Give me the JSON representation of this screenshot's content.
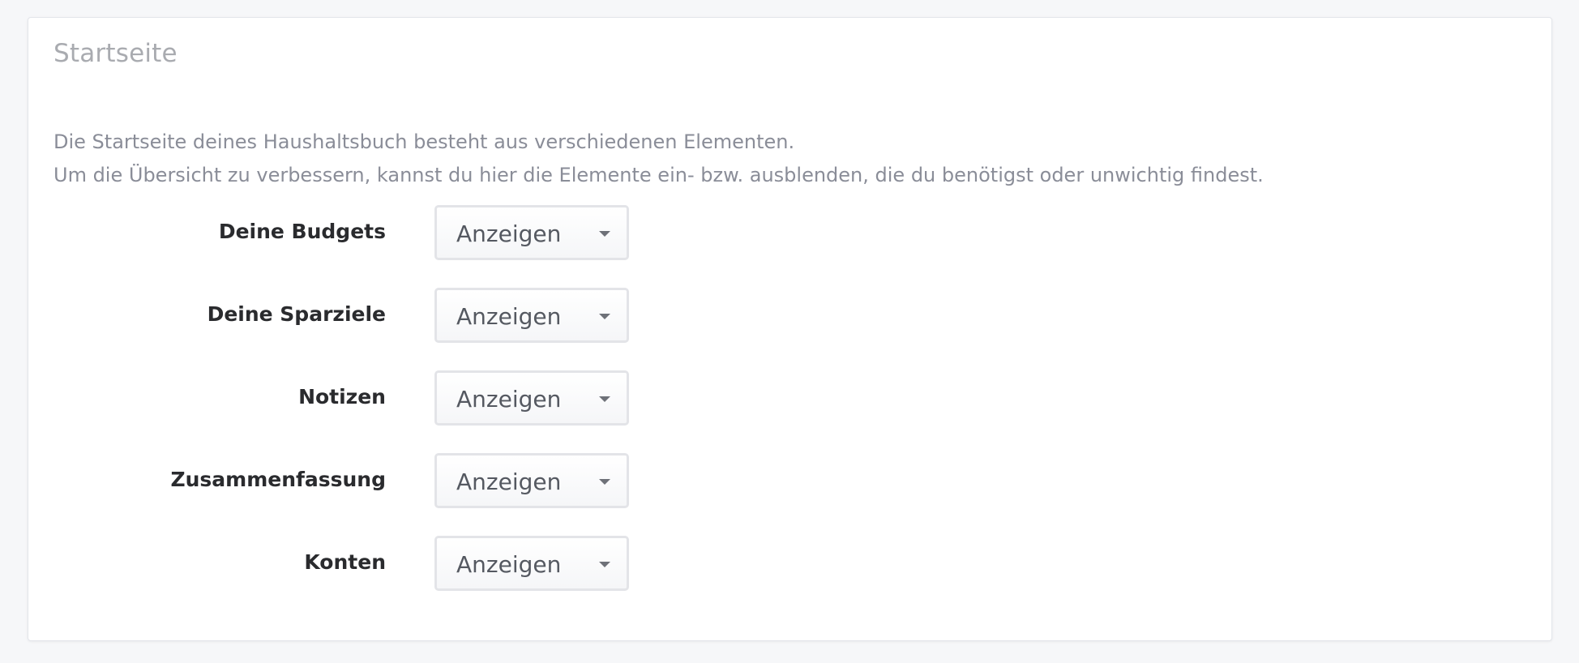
{
  "panel": {
    "title": "Startseite",
    "description": [
      "Die Startseite deines Haushaltsbuch besteht aus verschiedenen Elementen.",
      "Um die Übersicht zu verbessern, kannst du hier die Elemente ein- bzw. ausblenden, die du benötigst oder unwichtig findest."
    ]
  },
  "settings": [
    {
      "label": "Deine Budgets",
      "value": "Anzeigen"
    },
    {
      "label": "Deine Sparziele",
      "value": "Anzeigen"
    },
    {
      "label": "Notizen",
      "value": "Anzeigen"
    },
    {
      "label": "Zusammenfassung",
      "value": "Anzeigen"
    },
    {
      "label": "Konten",
      "value": "Anzeigen"
    }
  ],
  "icons": {
    "select_caret": "chevron-down-icon"
  },
  "colors": {
    "title": "#a9abb0",
    "description": "#8a8d98",
    "label": "#2a2b2e",
    "select_border": "#e3e4e8",
    "background": "#f6f7f9"
  }
}
